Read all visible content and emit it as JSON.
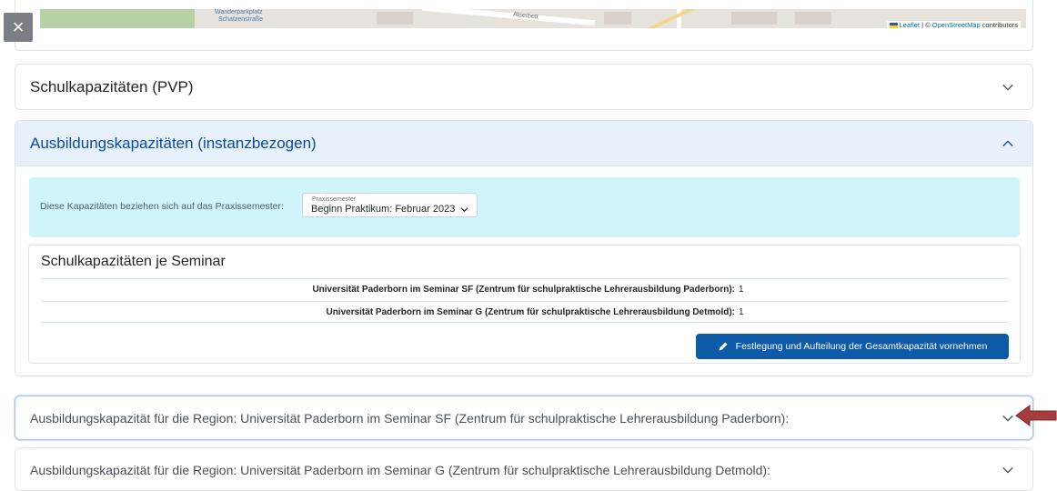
{
  "close_button": {
    "label": "×"
  },
  "map": {
    "labels": [
      "Wanderparkplatz",
      "Schatzenstraße",
      "Alserbett",
      "Leaflet",
      "OpenStreetMap"
    ],
    "attribution": {
      "leaflet": "Leaflet",
      "separator": " | © ",
      "osm": "OpenStreetMap",
      "suffix": " contributors"
    }
  },
  "accordion_pvp": {
    "title": "Schulkapazitäten (PVP)"
  },
  "accordion_ausbildung": {
    "title": "Ausbildungskapazitäten (instanzbezogen)",
    "info_text": "Diese Kapazitäten beziehen sich auf das Praxissemester:",
    "select": {
      "label": "Praxissemester",
      "value": "Beginn Praktikum: Februar 2023"
    },
    "card": {
      "title": "Schulkapazitäten je Seminar",
      "rows": [
        {
          "label": "Universität Paderborn im Seminar SF (Zentrum für schulpraktische Lehrerausbildung Paderborn):",
          "value": "1"
        },
        {
          "label": "Universität Paderborn im Seminar G (Zentrum für schulpraktische Lehrerausbildung Detmold):",
          "value": "1"
        }
      ],
      "button_label": "Festlegung und Aufteilung der Gesamtkapazität vornehmen"
    }
  },
  "region_sf": {
    "title": "Ausbildungskapazität für die Region: Universität Paderborn  im Seminar SF  (Zentrum für schulpraktische Lehrerausbildung Paderborn):"
  },
  "region_g": {
    "title": "Ausbildungskapazität für die Region: Universität Paderborn  im Seminar G  (Zentrum für schulpraktische Lehrerausbildung Detmold):"
  },
  "colors": {
    "primary": "#0d5aa7",
    "info_bg": "#cff4fc",
    "header_active": "#e7f1fb",
    "arrow": "#a43d3d"
  },
  "icons": [
    "close-icon",
    "chevron-down-icon",
    "chevron-up-icon",
    "pencil-icon",
    "arrow-left-icon"
  ]
}
